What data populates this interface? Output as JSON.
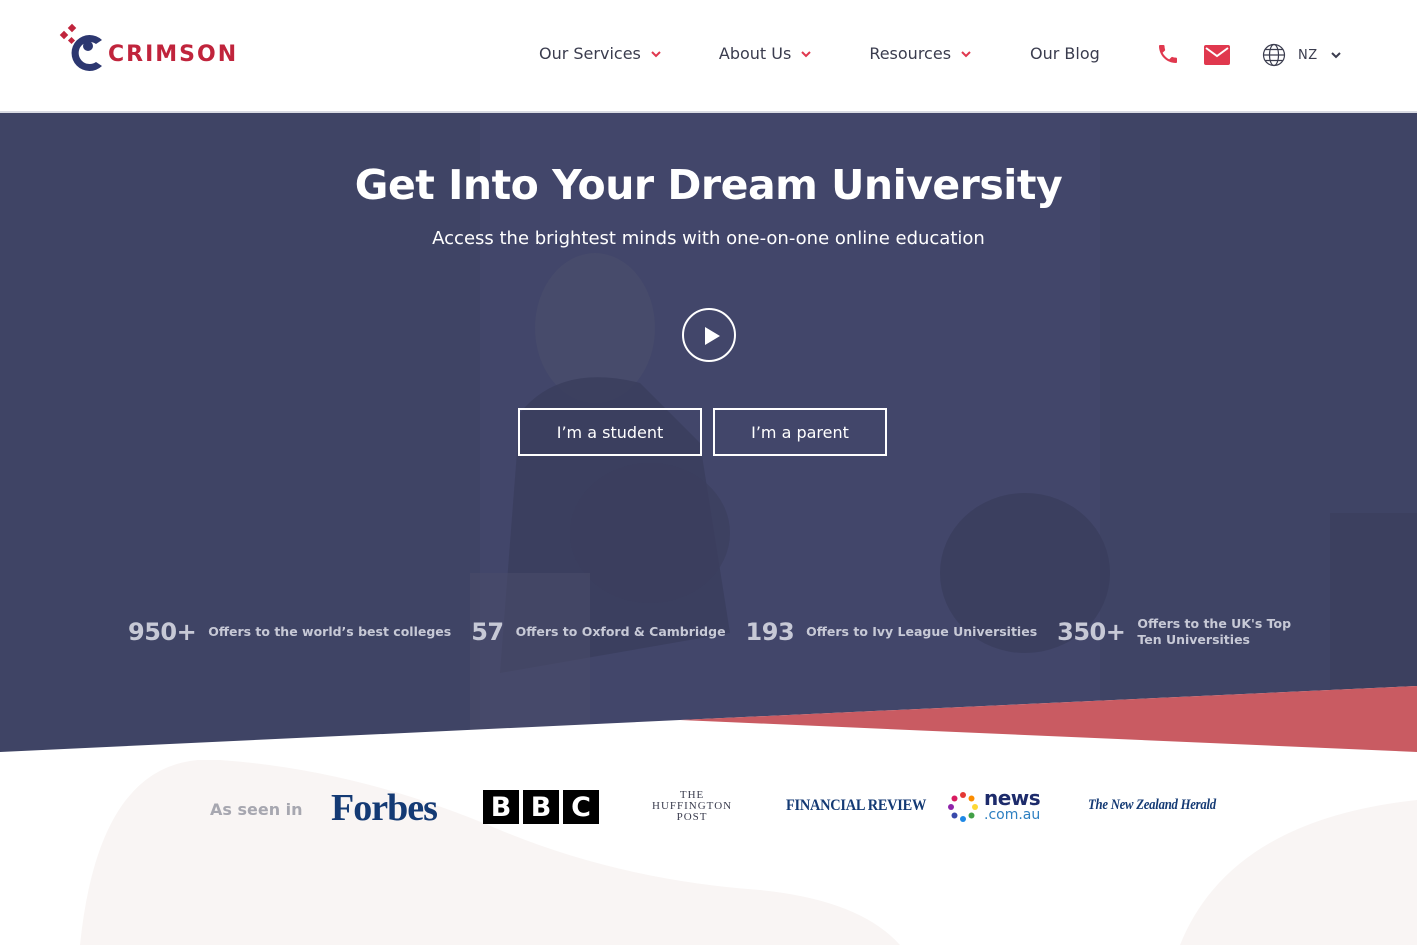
{
  "brand": {
    "name": "CRIMSON",
    "accent": "#c0243c",
    "navy": "#2c3770"
  },
  "nav": {
    "items": [
      {
        "label": "Our Services",
        "has_dropdown": true
      },
      {
        "label": "About Us",
        "has_dropdown": true
      },
      {
        "label": "Resources",
        "has_dropdown": true
      },
      {
        "label": "Our Blog",
        "has_dropdown": false
      }
    ],
    "phone_icon": "phone-icon",
    "email_icon": "mail-icon",
    "locale": {
      "icon": "globe-icon",
      "value": "NZ"
    }
  },
  "hero": {
    "title": "Get Into Your Dream University",
    "subtitle": "Access the brightest minds with one-on-one online education",
    "play_icon": "play-icon",
    "buttons": {
      "student": "I’m a student",
      "parent": "I’m a parent"
    },
    "stats": [
      {
        "number": "950+",
        "label": "Offers to the world’s best colleges"
      },
      {
        "number": "57",
        "label": "Offers to Oxford & Cambridge"
      },
      {
        "number": "193",
        "label": "Offers to Ivy League Universities"
      },
      {
        "number": "350+",
        "label": "Offers to the UK's Top Ten Universities"
      }
    ]
  },
  "press": {
    "label": "As seen in",
    "logos": {
      "forbes": "Forbes",
      "bbc": [
        "B",
        "B",
        "C"
      ],
      "huffington": [
        "THE",
        "HUFFINGTON",
        "POST"
      ],
      "financial_review": "FINANCIAL REVIEW",
      "news_main": "news",
      "news_sub": ".com.au",
      "nzherald": "The New Zealand Herald"
    }
  }
}
